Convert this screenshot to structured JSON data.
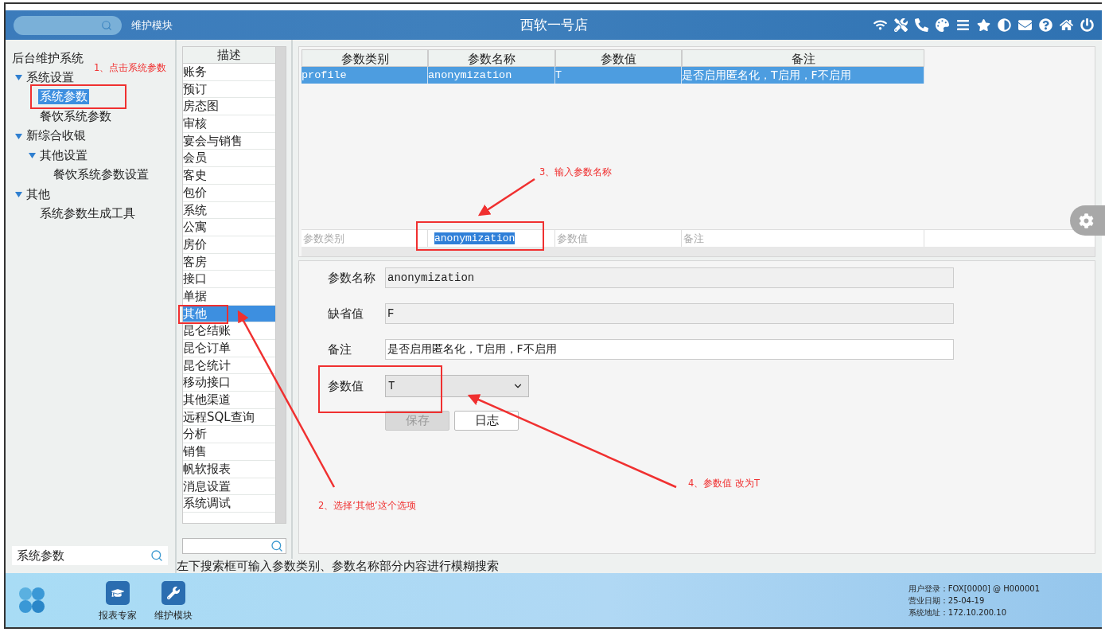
{
  "header": {
    "module_label": "维护模块",
    "title": "西软一号店"
  },
  "sidebar": {
    "title": "后台维护系统",
    "tree": [
      {
        "label": "系统设置",
        "expanded": true,
        "selected": false,
        "children": [
          {
            "label": "系统参数",
            "selected": true
          },
          {
            "label": "餐饮系统参数",
            "selected": false
          }
        ]
      },
      {
        "label": "新综合收银",
        "expanded": true,
        "selected": false,
        "children": [
          {
            "label": "其他设置",
            "expanded": true,
            "selected": false,
            "children": [
              {
                "label": "餐饮系统参数设置",
                "selected": false
              }
            ]
          }
        ]
      },
      {
        "label": "其他",
        "expanded": true,
        "selected": false,
        "children": [
          {
            "label": "系统参数生成工具",
            "selected": false
          }
        ]
      }
    ],
    "search": {
      "value": "系统参数"
    }
  },
  "category_list": {
    "header": "描述",
    "items": [
      {
        "label": "账务",
        "selected": false
      },
      {
        "label": "预订",
        "selected": false
      },
      {
        "label": "房态图",
        "selected": false
      },
      {
        "label": "审核",
        "selected": false
      },
      {
        "label": "宴会与销售",
        "selected": false
      },
      {
        "label": "会员",
        "selected": false
      },
      {
        "label": "客史",
        "selected": false
      },
      {
        "label": "包价",
        "selected": false
      },
      {
        "label": "系统",
        "selected": false
      },
      {
        "label": "公寓",
        "selected": false
      },
      {
        "label": "房价",
        "selected": false
      },
      {
        "label": "客房",
        "selected": false
      },
      {
        "label": "接口",
        "selected": false
      },
      {
        "label": "单据",
        "selected": false
      },
      {
        "label": "其他",
        "selected": true
      },
      {
        "label": "昆仑结账",
        "selected": false
      },
      {
        "label": "昆仑订单",
        "selected": false
      },
      {
        "label": "昆仑统计",
        "selected": false
      },
      {
        "label": "移动接口",
        "selected": false
      },
      {
        "label": "其他渠道",
        "selected": false
      },
      {
        "label": "远程SQL查询",
        "selected": false
      },
      {
        "label": "分析",
        "selected": false
      },
      {
        "label": "销售",
        "selected": false
      },
      {
        "label": "帆软报表",
        "selected": false
      },
      {
        "label": "消息设置",
        "selected": false
      },
      {
        "label": "系统调试",
        "selected": false
      }
    ]
  },
  "param_table": {
    "columns": [
      "参数类别",
      "参数名称",
      "参数值",
      "备注"
    ],
    "rows": [
      {
        "cells": [
          "profile",
          "anonymization",
          "T",
          "是否启用匿名化，T启用，F不启用"
        ],
        "selected": true
      }
    ],
    "filters": [
      {
        "placeholder": "参数类别"
      },
      {
        "value": "anonymization"
      },
      {
        "placeholder": "参数值"
      },
      {
        "placeholder": "备注"
      }
    ]
  },
  "form": {
    "fields": [
      {
        "kind": "readonly",
        "label": "参数名称",
        "value": "anonymization"
      },
      {
        "kind": "readonly",
        "label": "缺省值",
        "value": "F"
      },
      {
        "kind": "text",
        "label": "备注",
        "value": "是否启用匿名化，T启用，F不启用"
      },
      {
        "kind": "select",
        "label": "参数值",
        "value": "T"
      }
    ],
    "buttons": [
      {
        "label": "保存",
        "disabled": true
      },
      {
        "label": "日志",
        "disabled": false
      }
    ]
  },
  "hint": "左下搜索框可输入参数类别、参数名称部分内容进行模糊搜索",
  "taskbar": {
    "apps": [
      {
        "kind": "report",
        "label": "报表专家"
      },
      {
        "kind": "maintenance",
        "label": "维护模块"
      }
    ],
    "info": [
      "用户登录：FOX[0000] @ H000001",
      "营业日期：25-04-19",
      "系统地址：172.10.200.10"
    ]
  },
  "annotations": [
    {
      "text": "1、点击系统参数"
    },
    {
      "text": "2、选择‘其他’这个选项"
    },
    {
      "text": "3、输入参数名称"
    },
    {
      "text": "4、参数值 改为T"
    }
  ]
}
